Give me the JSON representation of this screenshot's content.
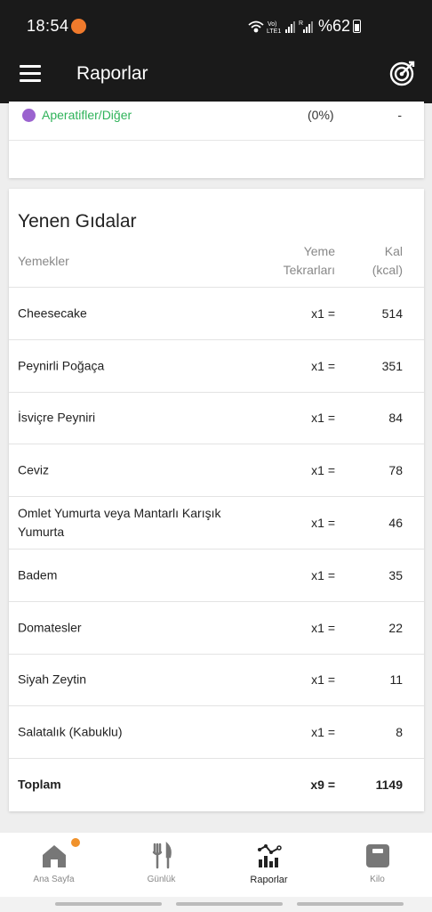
{
  "status": {
    "time": "18:54",
    "battery": "%62",
    "signal_labels": [
      "Vo)",
      "LTE1",
      "R"
    ]
  },
  "app_bar": {
    "title": "Raporlar"
  },
  "category": {
    "label": "Aperatifler/Diğer",
    "percent": "(0%)",
    "value": "-"
  },
  "section": {
    "title": "Yenen Gıdalar",
    "col_foods": "Yemekler",
    "col_reps_1": "Yeme",
    "col_reps_2": "Tekrarları",
    "col_kcal_1": "Kal",
    "col_kcal_2": "(kcal)"
  },
  "foods": [
    {
      "name": "Cheesecake",
      "reps": "x1 =",
      "kcal": "514"
    },
    {
      "name": "Peynirli Poğaça",
      "reps": "x1 =",
      "kcal": "351"
    },
    {
      "name": "İsviçre Peyniri",
      "reps": "x1 =",
      "kcal": "84"
    },
    {
      "name": "Ceviz",
      "reps": "x1 =",
      "kcal": "78"
    },
    {
      "name": "Omlet Yumurta veya Mantarlı Karışık Yumurta",
      "reps": "x1 =",
      "kcal": "46"
    },
    {
      "name": "Badem",
      "reps": "x1 =",
      "kcal": "35"
    },
    {
      "name": "Domatesler",
      "reps": "x1 =",
      "kcal": "22"
    },
    {
      "name": "Siyah Zeytin",
      "reps": "x1 =",
      "kcal": "11"
    },
    {
      "name": "Salatalık (Kabuklu)",
      "reps": "x1 =",
      "kcal": "8"
    }
  ],
  "total": {
    "label": "Toplam",
    "reps": "x9 =",
    "kcal": "1149"
  },
  "nav": [
    {
      "label": "Ana Sayfa",
      "icon": "home-icon"
    },
    {
      "label": "Günlük",
      "icon": "cutlery-icon"
    },
    {
      "label": "Raporlar",
      "icon": "report-chart-icon"
    },
    {
      "label": "Kilo",
      "icon": "scale-icon"
    }
  ],
  "colors": {
    "accent_green": "#2fb35a",
    "category_purple": "#9b63cf",
    "badge_orange": "#f0922c",
    "bar_dark": "#1a1a1a"
  }
}
